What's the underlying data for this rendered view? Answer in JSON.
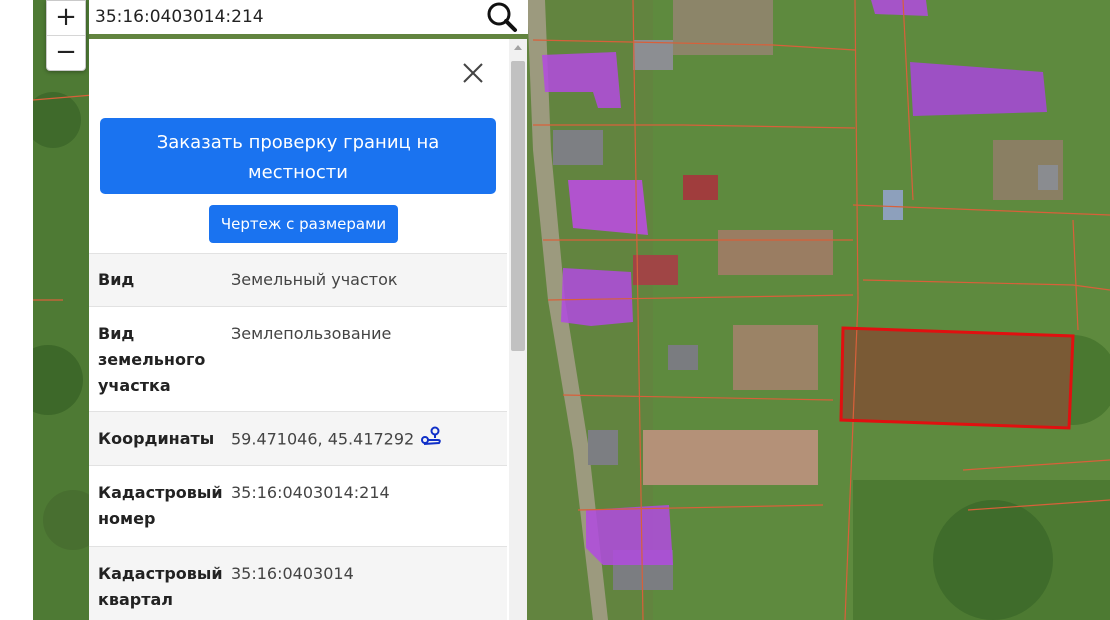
{
  "search": {
    "value": "35:16:0403014:214",
    "placeholder": ""
  },
  "zoom": {
    "in_label": "+",
    "out_label": "−"
  },
  "panel": {
    "order_button_label": "Заказать проверку границ на местности",
    "drawing_button_label": "Чертеж с размерами",
    "rows": [
      {
        "label": "Вид",
        "value": "Земельный участок"
      },
      {
        "label": "Вид земельного участка",
        "value": "Землепользование"
      },
      {
        "label": "Координаты",
        "value": "59.471046, 45.417292"
      },
      {
        "label": "Кадастровый номер",
        "value": "35:16:0403014:214"
      },
      {
        "label": "Кадастровый квартал",
        "value": "35:16:0403014"
      }
    ]
  },
  "icons": {
    "search": "search-icon",
    "close": "close-icon",
    "route": "route-icon"
  },
  "colors": {
    "primary_button": "#1a73f0",
    "selected_parcel": "#e01010",
    "parcel_border": "#d8603a",
    "building_overlay": "#b44ae0"
  }
}
